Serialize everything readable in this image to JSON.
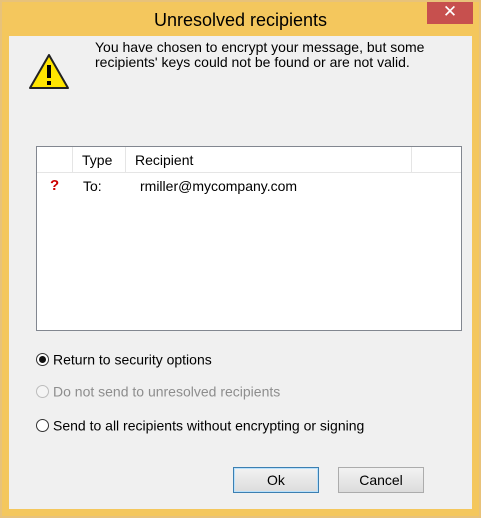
{
  "dialog": {
    "title": "Unresolved recipients",
    "close_glyph": "✕",
    "message": "You have chosen to encrypt your message, but some recipients' keys could not be found or are not valid."
  },
  "icons": {
    "warning": "warning-triangle-icon",
    "status": "unresolved-question-icon"
  },
  "list": {
    "columns": [
      "Type",
      "Recipient"
    ],
    "rows": [
      {
        "status_glyph": "?",
        "type": "To:",
        "recipient": "rmiller@mycompany.com"
      }
    ]
  },
  "options": [
    {
      "label": "Return to security options",
      "selected": true,
      "enabled": true
    },
    {
      "label": "Do not send to unresolved recipients",
      "selected": false,
      "enabled": false
    },
    {
      "label": "Send to all recipients without encrypting or signing",
      "selected": false,
      "enabled": true
    }
  ],
  "buttons": {
    "ok": "Ok",
    "cancel": "Cancel"
  },
  "colors": {
    "titlebar": "#f4c75d",
    "close": "#c7504e",
    "status": "#cc0000"
  }
}
